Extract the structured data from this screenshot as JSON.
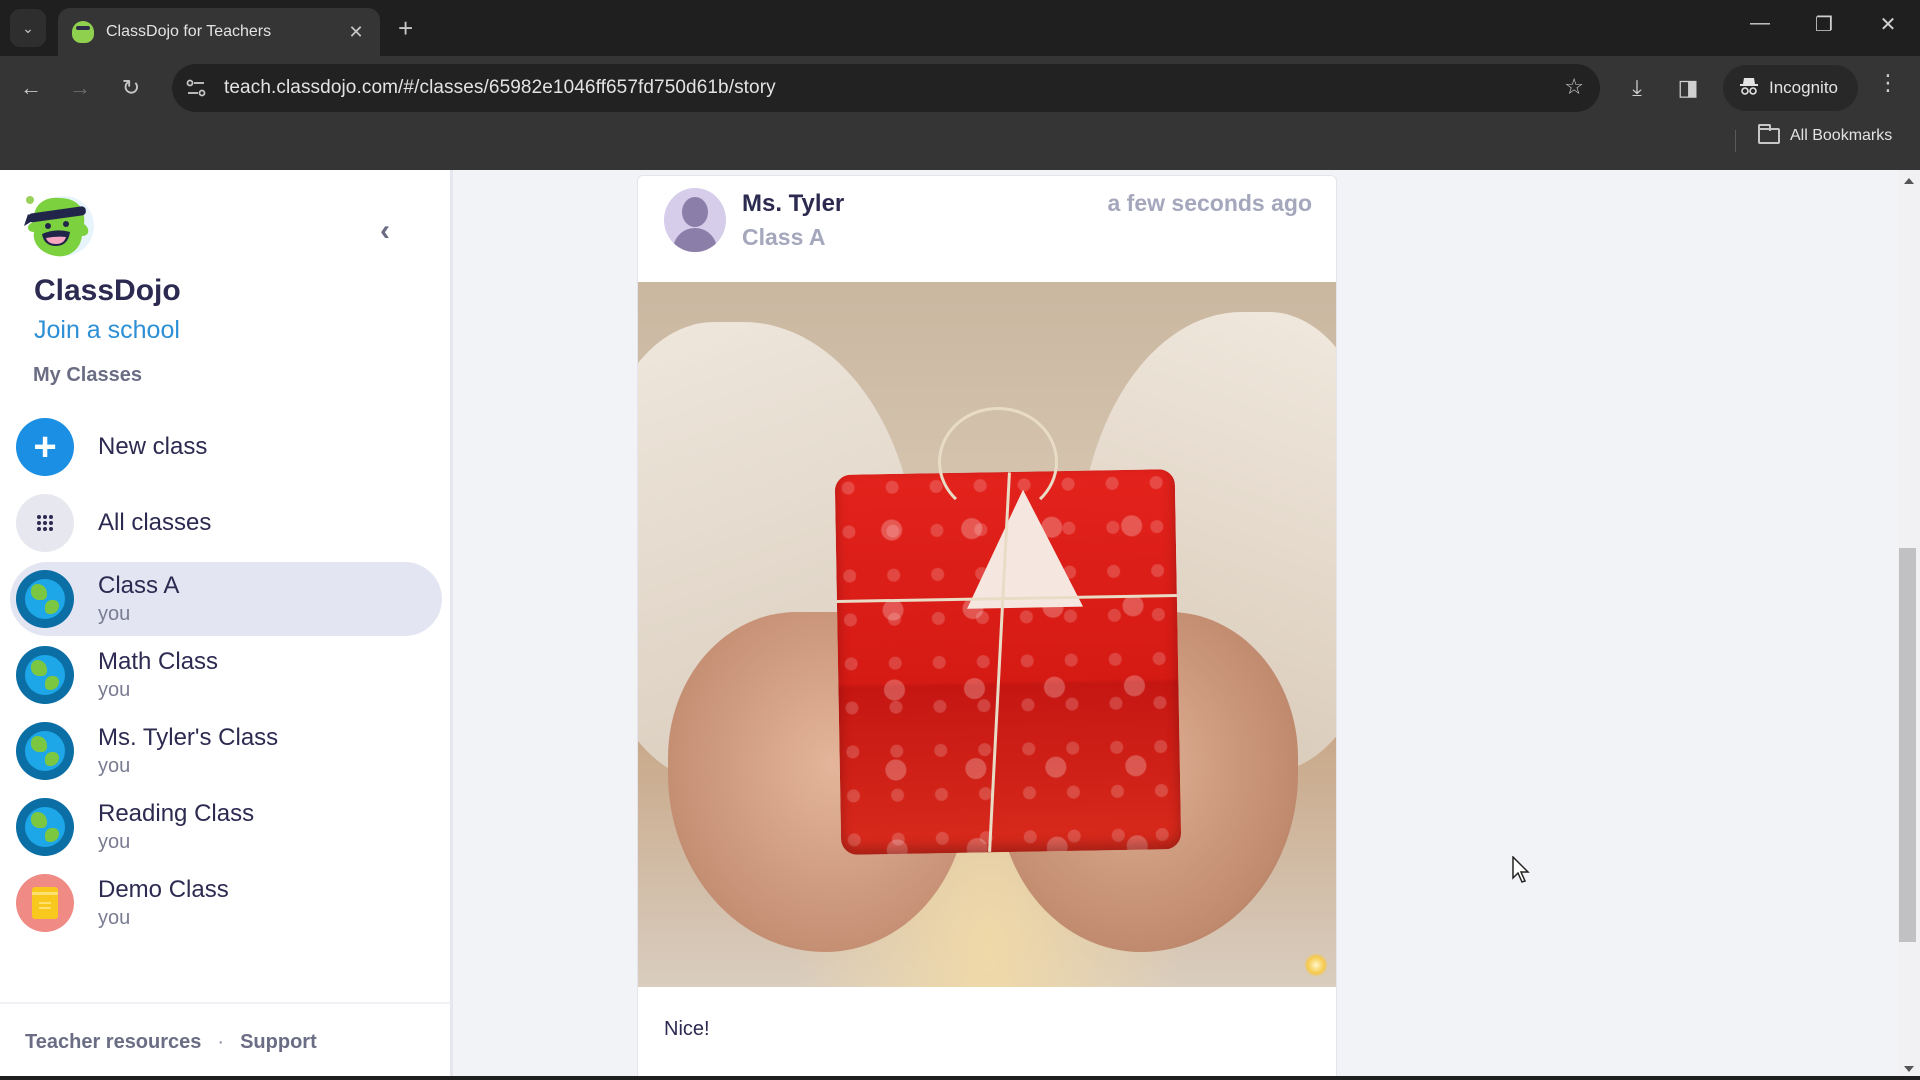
{
  "browser": {
    "tab": {
      "title": "ClassDojo for Teachers",
      "favicon": "classdojo-monster-icon"
    },
    "url": "teach.classdojo.com/#/classes/65982e1046ff657fd750d61b/story",
    "incognito_label": "Incognito",
    "bookmarks_label": "All Bookmarks",
    "icons": {
      "tab_search": "chevron-down-icon",
      "close_tab": "close-icon",
      "new_tab": "plus-icon",
      "back": "arrow-left-icon",
      "forward": "arrow-right-icon",
      "reload": "reload-icon",
      "site_info": "tune-icon",
      "bookmark": "star-icon",
      "downloads": "download-icon",
      "side_panel": "side-panel-icon",
      "incognito": "incognito-icon",
      "menu": "kebab-menu-icon",
      "minimize": "minimize-icon",
      "restore": "restore-icon",
      "close_window": "close-icon"
    },
    "glyphs": {
      "tab_search": "⌄",
      "close_tab": "✕",
      "new_tab": "+",
      "back": "←",
      "forward": "→",
      "reload": "↻",
      "star": "☆",
      "download": "⤓",
      "side_panel": "◨",
      "menu": "⋮",
      "minimize": "—",
      "restore": "❐",
      "close_window": "✕",
      "collapse": "‹",
      "plus": "+"
    }
  },
  "sidebar": {
    "brand": "ClassDojo",
    "join_school": "Join a school",
    "section_label": "My Classes",
    "actions": [
      {
        "label": "New class",
        "icon": "plus-icon"
      },
      {
        "label": "All classes",
        "icon": "grid-icon"
      }
    ],
    "classes": [
      {
        "name": "Class A",
        "owner": "you",
        "icon": "globe-icon",
        "active": true
      },
      {
        "name": "Math Class",
        "owner": "you",
        "icon": "globe-icon",
        "active": false
      },
      {
        "name": "Ms. Tyler's Class",
        "owner": "you",
        "icon": "globe-icon",
        "active": false
      },
      {
        "name": "Reading Class",
        "owner": "you",
        "icon": "globe-icon",
        "active": false
      },
      {
        "name": "Demo Class",
        "owner": "you",
        "icon": "notebook-icon",
        "active": false
      }
    ],
    "footer": {
      "teacher_resources": "Teacher resources",
      "separator": "·",
      "support": "Support"
    }
  },
  "post": {
    "author": "Ms. Tyler",
    "class": "Class A",
    "time": "a few seconds ago",
    "image_description": "Hands holding a red wrapped gift box tied with twine",
    "caption": "Nice!"
  },
  "colors": {
    "accent_blue": "#1a8fe3",
    "link_blue": "#2d8fd5",
    "text_dark": "#2c2a50",
    "text_muted": "#6b6d85",
    "active_item_bg": "#e3e5f2"
  }
}
